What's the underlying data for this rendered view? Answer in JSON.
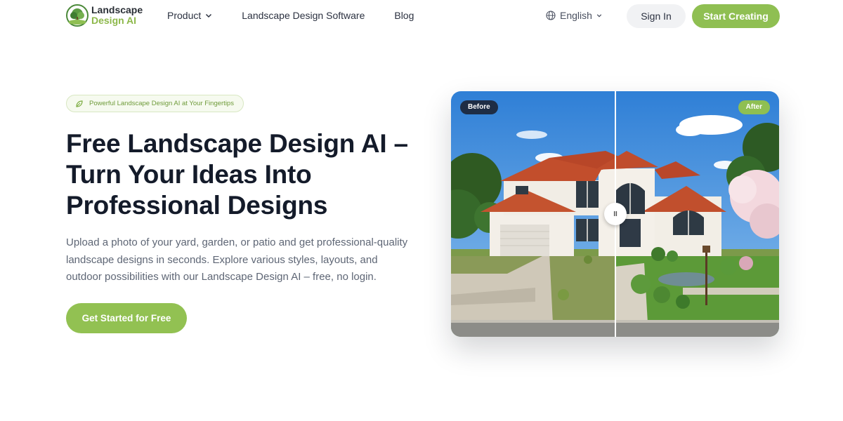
{
  "brand": {
    "line1": "Landscape",
    "line2": "Design AI"
  },
  "nav": {
    "product": "Product",
    "software": "Landscape Design Software",
    "blog": "Blog"
  },
  "language": "English",
  "auth": {
    "sign_in": "Sign In",
    "start": "Start Creating"
  },
  "hero": {
    "badge": "Powerful Landscape Design AI at Your Fingertips",
    "headline": "Free Landscape Design AI – Turn Your Ideas Into Professional Designs",
    "subtitle": "Upload a photo of your yard, garden, or patio and get professional-quality landscape designs in seconds. Explore various styles, layouts, and outdoor possibilities with our Landscape Design AI – free, no login.",
    "cta": "Get Started for Free"
  },
  "compare": {
    "before": "Before",
    "after": "After",
    "handle": "II"
  },
  "colors": {
    "accent": "#8fbf52",
    "dark": "#141b2a",
    "before_tag": "#1e2d45"
  },
  "icons": [
    "logo-tree-icon",
    "chevron-down-icon",
    "globe-icon",
    "leaf-icon"
  ]
}
